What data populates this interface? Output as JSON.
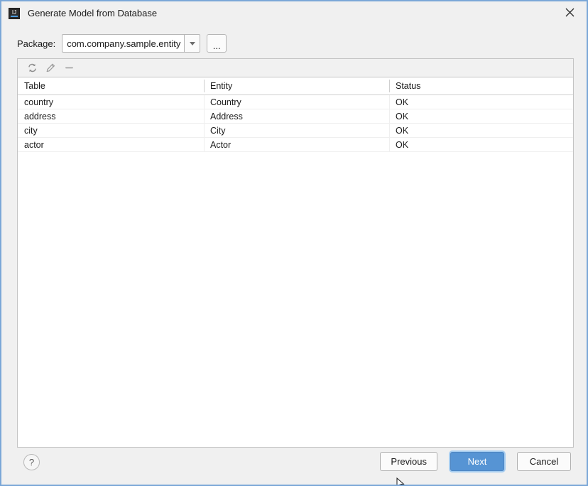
{
  "window": {
    "title": "Generate Model from Database",
    "app_icon": "intellij-idea-icon",
    "icon_letters": "IJ",
    "close_label": "✕",
    "border_color": "#7ba7d7"
  },
  "package_row": {
    "label": "Package:",
    "value": "com.company.sample.entity",
    "placeholder": "com.company.sample.entity",
    "dropdown_icon": "chevron-down-icon",
    "browse_label": "..."
  },
  "table_toolbar": {
    "icons": [
      {
        "name": "refresh-icon",
        "tooltip": "Refresh"
      },
      {
        "name": "edit-pencil-icon",
        "tooltip": "Edit"
      },
      {
        "name": "remove-minus-icon",
        "tooltip": "Remove"
      }
    ]
  },
  "table": {
    "columns": [
      "Table",
      "Entity",
      "Status"
    ],
    "rows": [
      {
        "table": "country",
        "entity": "Country",
        "status": "OK"
      },
      {
        "table": "address",
        "entity": "Address",
        "status": "OK"
      },
      {
        "table": "city",
        "entity": "City",
        "status": "OK"
      },
      {
        "table": "actor",
        "entity": "Actor",
        "status": "OK"
      }
    ]
  },
  "footer": {
    "help_label": "?",
    "previous_label": "Previous",
    "next_label": "Next",
    "cancel_label": "Cancel",
    "default_button_color": "#5694d4"
  }
}
